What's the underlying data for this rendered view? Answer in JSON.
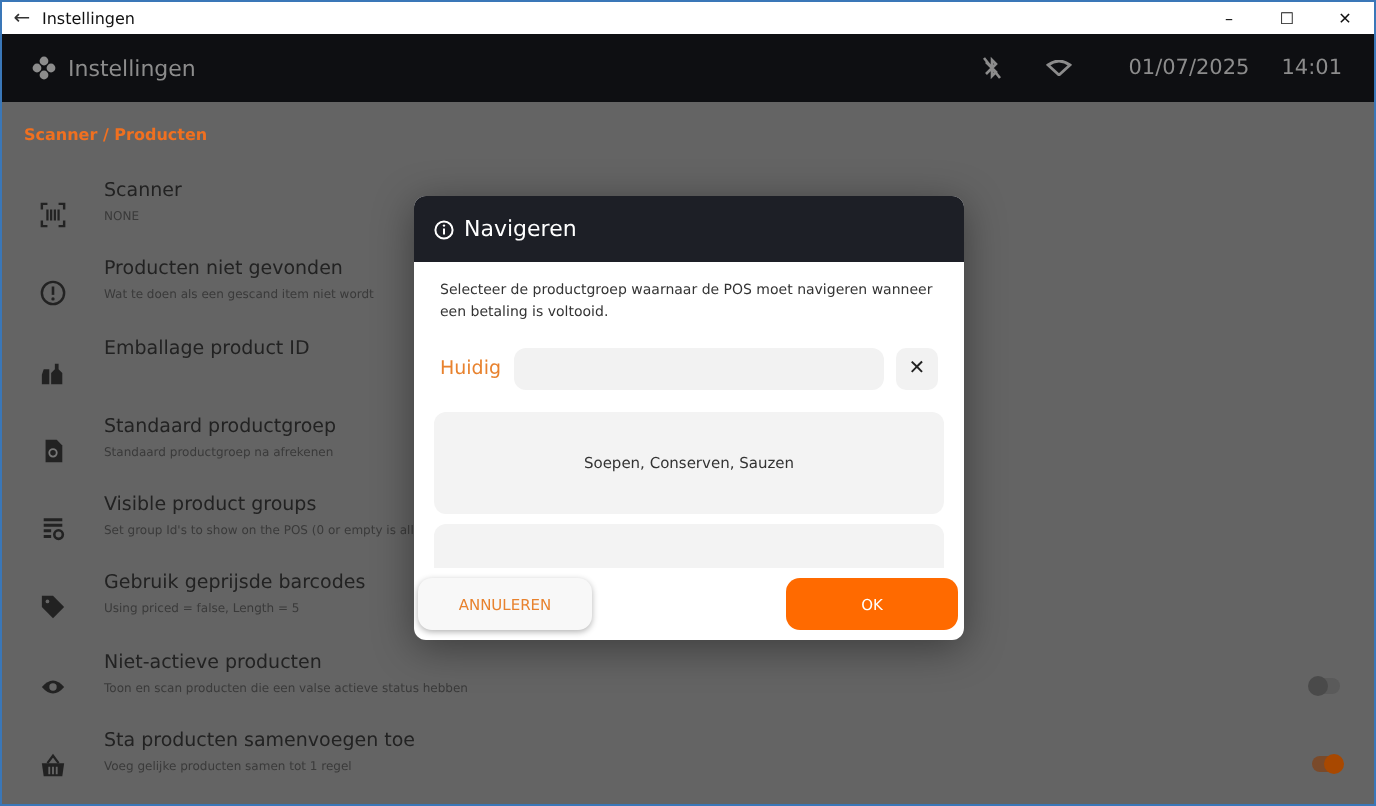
{
  "window": {
    "title": "Instellingen",
    "back": "←",
    "controls": [
      "–",
      "☐",
      "✕"
    ]
  },
  "header": {
    "title": "Instellingen",
    "date": "01/07/2025",
    "time": "14:01"
  },
  "breadcrumb": "Scanner / Producten",
  "settings": [
    {
      "title": "Scanner",
      "subtitle": "NONE"
    },
    {
      "title": "Producten niet gevonden",
      "subtitle": "Wat te doen als een gescand item niet wordt"
    },
    {
      "title": "Emballage product ID"
    },
    {
      "title": "Standaard productgroep",
      "subtitle": "Standaard productgroep na afrekenen"
    },
    {
      "title": "Visible product groups",
      "subtitle": "Set group Id's to show on the POS (0 or empty is all"
    },
    {
      "title": "Gebruik geprijsde barcodes",
      "subtitle": "Using priced = false, Length = 5"
    },
    {
      "title": "Niet-actieve producten",
      "subtitle": "Toon en scan producten die een valse actieve status hebben",
      "on": false
    },
    {
      "title": "Sta producten samenvoegen toe",
      "subtitle": "Voeg gelijke producten samen tot 1 regel",
      "on": true
    }
  ],
  "dialog": {
    "title": "Navigeren",
    "description": "Selecteer de productgroep waarnaar de POS moet navigeren wanneer een betaling is voltooid.",
    "current_label": "Huidig",
    "clear": "✕",
    "groups": [
      "Soepen, Conserven, Sauzen"
    ],
    "cancel": "ANNULEREN",
    "ok": "OK"
  }
}
